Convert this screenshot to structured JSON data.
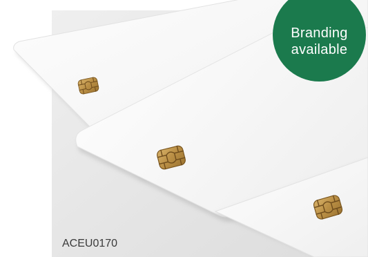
{
  "badge": {
    "line1": "Branding",
    "line2": "available",
    "color": "#1b7a4d"
  },
  "product": {
    "code": "ACEU0170"
  },
  "colors": {
    "background": "#e9e9e9",
    "card": "#fbfbfb",
    "chip": "#c29a4e",
    "chip_dark": "#6e4c1c"
  },
  "icons": [
    "smart-card-chip-icon"
  ]
}
